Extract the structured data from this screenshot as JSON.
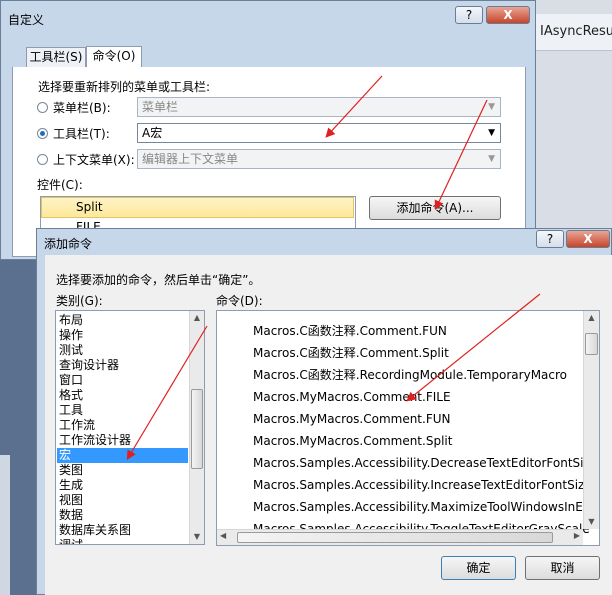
{
  "background": {
    "right_window_title": "IAsyncResult",
    "title_fragment": "Split FILE"
  },
  "customize_dialog": {
    "title": "自定义",
    "help_button": "?",
    "close_button": "X",
    "tabs": [
      {
        "label": "工具栏(S)",
        "active": false
      },
      {
        "label": "命令(O)",
        "active": true
      }
    ],
    "prompt": "选择要重新排列的菜单或工具栏:",
    "options": [
      {
        "label": "菜单栏(B):",
        "value": "菜单栏",
        "selected": false,
        "enabled": false
      },
      {
        "label": "工具栏(T):",
        "value": "A宏",
        "selected": true,
        "enabled": true
      },
      {
        "label": "上下文菜单(X):",
        "value": "编辑器上下文菜单",
        "selected": false,
        "enabled": false
      }
    ],
    "controls_label": "控件(C):",
    "controls_items": [
      "Split",
      "FILE"
    ],
    "add_command_button": "添加命令(A)..."
  },
  "add_command_dialog": {
    "title": "添加命令",
    "help_button": "?",
    "close_button": "X",
    "instruction": "选择要添加的命令，然后单击“确定”。",
    "categories_label": "类别(G):",
    "commands_label": "命令(D):",
    "categories": [
      "布局",
      "操作",
      "测试",
      "查询设计器",
      "窗口",
      "格式",
      "工具",
      "工作流",
      "工作流设计器",
      "宏",
      "类图",
      "生成",
      "视图",
      "数据",
      "数据库关系图",
      "调试"
    ],
    "selected_category": "宏",
    "commands": [
      "Macros.C函数注释.Comment.FUN",
      "Macros.C函数注释.Comment.Split",
      "Macros.C函数注释.RecordingModule.TemporaryMacro",
      "Macros.MyMacros.Comment.FILE",
      "Macros.MyMacros.Comment.FUN",
      "Macros.MyMacros.Comment.Split",
      "Macros.Samples.Accessibility.DecreaseTextEditorFontSize",
      "Macros.Samples.Accessibility.IncreaseTextEditorFontSize",
      "Macros.Samples.Accessibility.MaximizeToolWindowsInEnviron",
      "Macros.Samples.Accessibility.ToggleTextEditorGrayScale"
    ],
    "ok_button": "确定",
    "cancel_button": "取消"
  },
  "icons": {
    "scroll_up": "scroll-up-arrow-icon",
    "scroll_down": "scroll-down-arrow-icon",
    "scroll_left": "scroll-left-arrow-icon",
    "scroll_right": "scroll-right-arrow-icon",
    "dropdown": "chevron-down-icon"
  },
  "colors": {
    "selection_blue": "#3399ff",
    "annotation_red": "#e02020",
    "dialog_frame": "#c7d7ea"
  }
}
